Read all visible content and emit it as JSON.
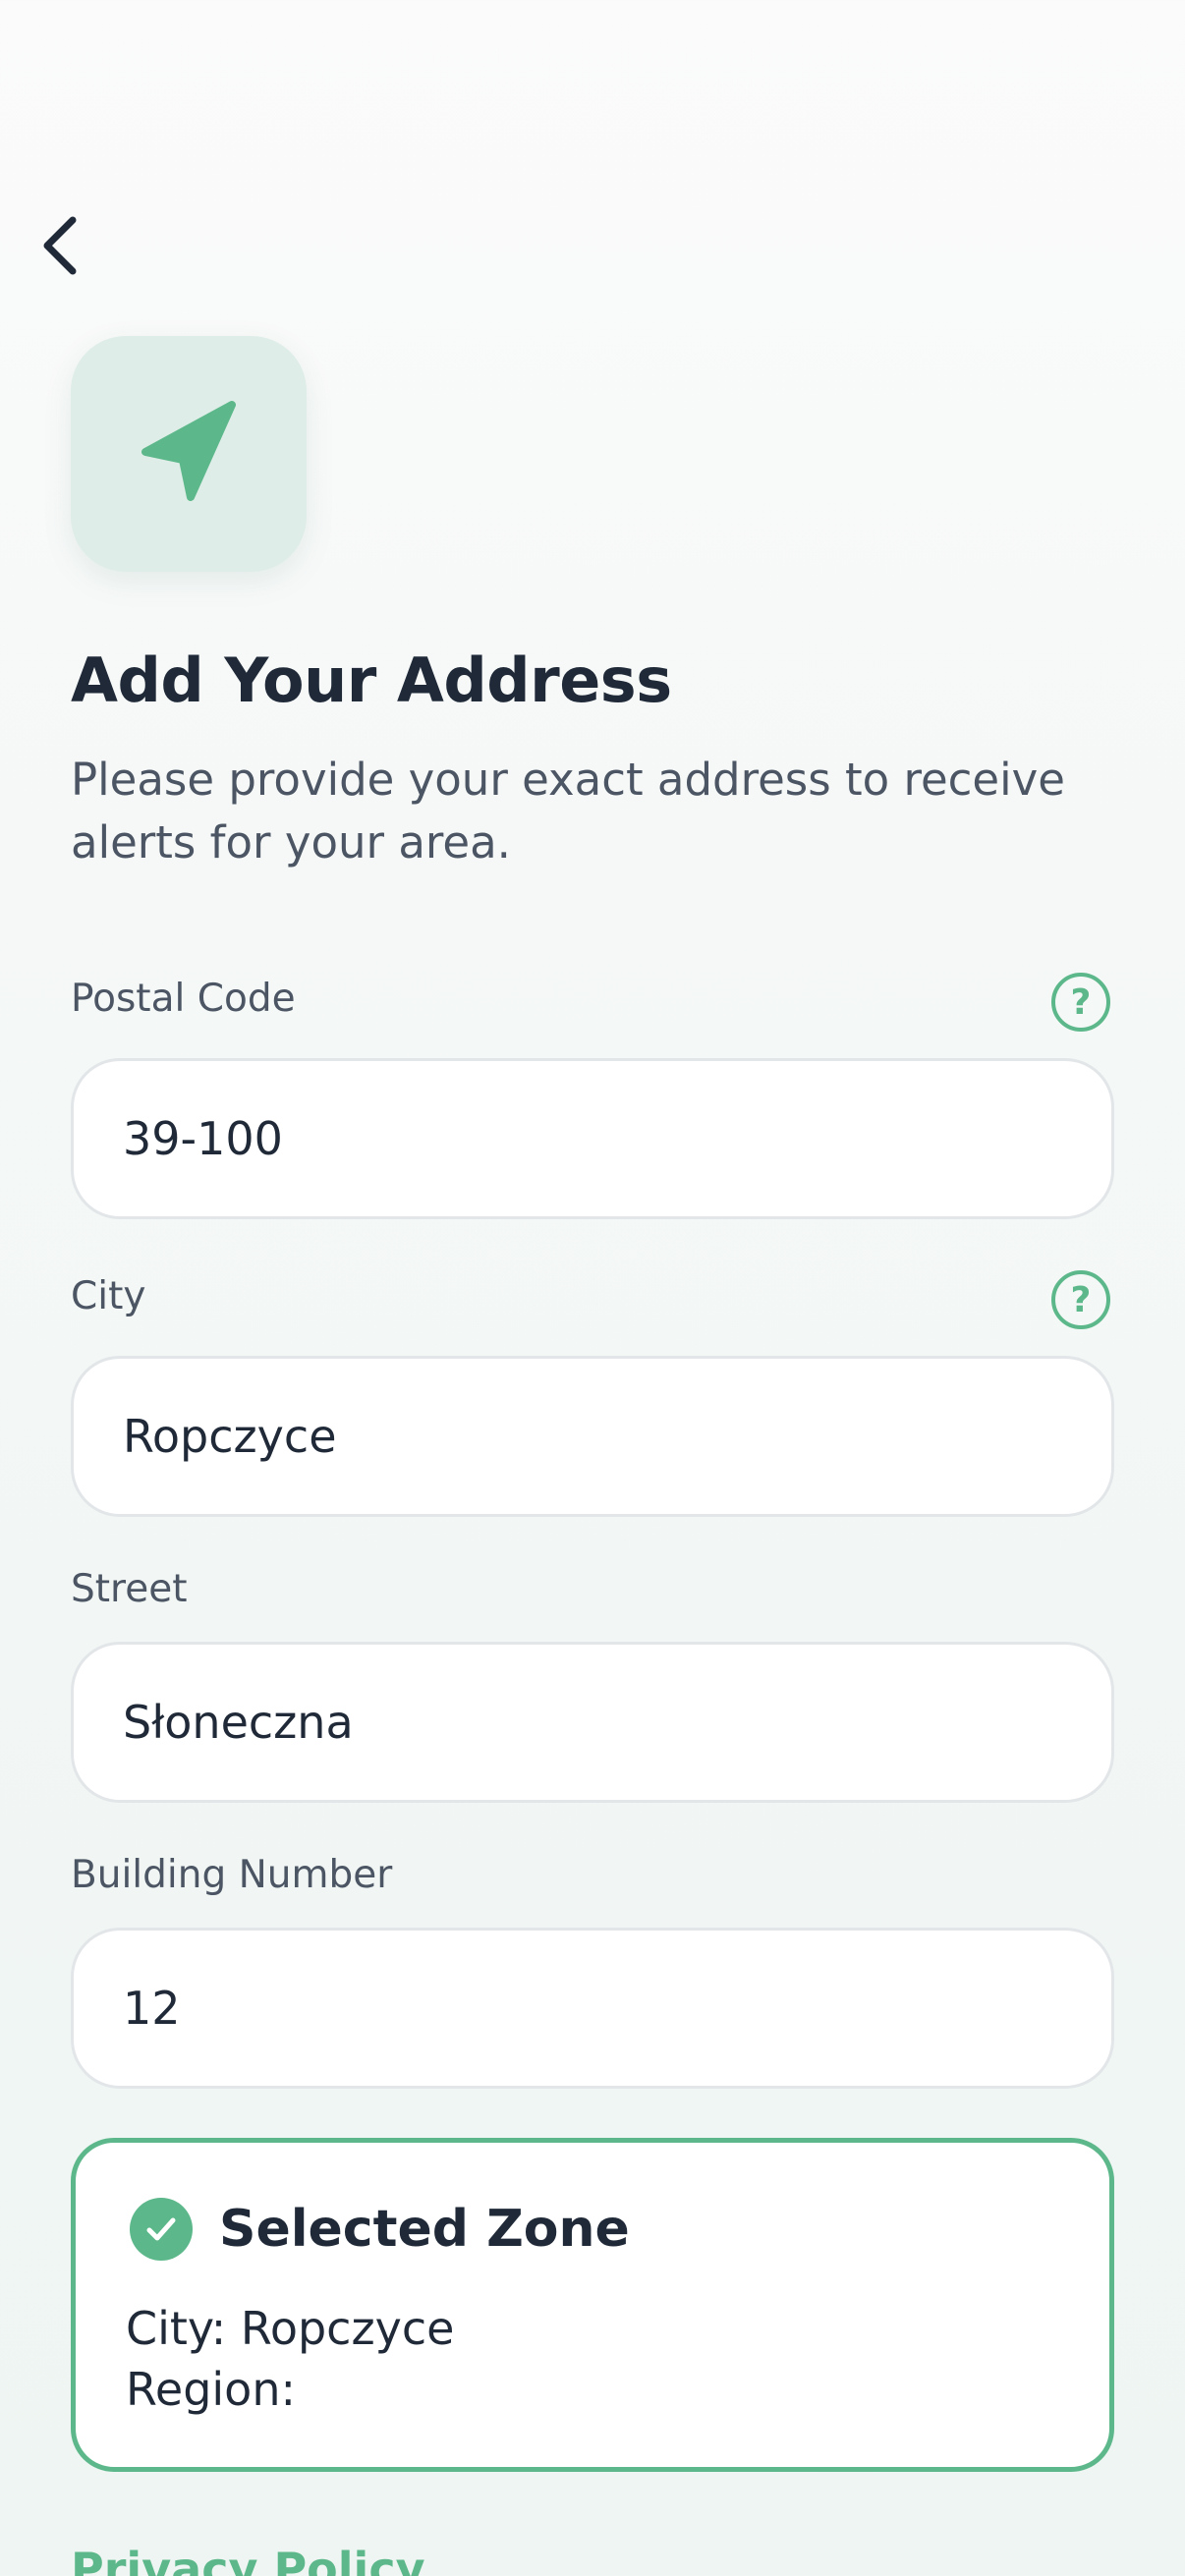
{
  "header": {
    "back_icon": "chevron-left-icon"
  },
  "hero": {
    "icon": "navigation-arrow-icon",
    "title": "Add Your Address",
    "subtitle": "Please provide your exact address to receive alerts for your area."
  },
  "form": {
    "postal_code": {
      "label": "Postal Code",
      "value": "39-100",
      "help_icon": "?"
    },
    "city": {
      "label": "City",
      "value": "Ropczyce",
      "help_icon": "?"
    },
    "street": {
      "label": "Street",
      "value": "Słoneczna"
    },
    "building_number": {
      "label": "Building Number",
      "value": "12"
    }
  },
  "zone": {
    "title": "Selected Zone",
    "city_line": "City: Ropczyce",
    "region_line": "Region:"
  },
  "footer": {
    "privacy_link": "Privacy Policy"
  },
  "colors": {
    "accent": "#5cb88a",
    "text_primary": "#1f2937",
    "text_secondary": "#4b5563",
    "icon_tile": "#deede7"
  }
}
